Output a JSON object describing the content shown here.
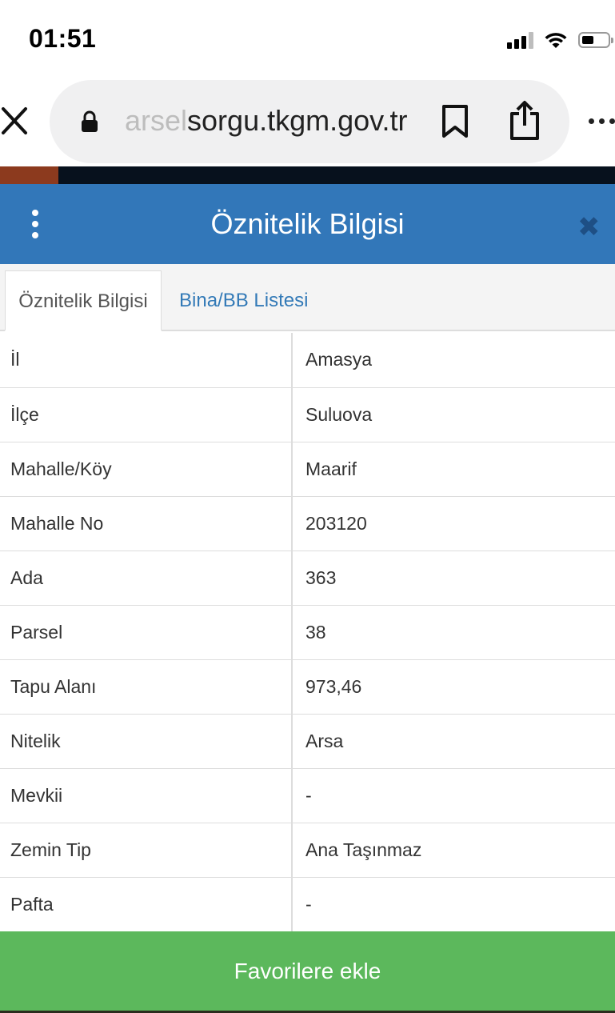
{
  "status_bar": {
    "time": "01:51",
    "battery_level": 0.45
  },
  "browser": {
    "url_faded": "arsel",
    "url_main": "sorgu.tkgm.gov.tr"
  },
  "modal": {
    "title": "Öznitelik Bilgisi",
    "tabs": [
      {
        "label": "Öznitelik Bilgisi",
        "active": true
      },
      {
        "label": "Bina/BB Listesi",
        "active": false
      }
    ],
    "rows": [
      {
        "key": "İl",
        "value": "Amasya"
      },
      {
        "key": "İlçe",
        "value": "Suluova"
      },
      {
        "key": "Mahalle/Köy",
        "value": "Maarif"
      },
      {
        "key": "Mahalle No",
        "value": "203120"
      },
      {
        "key": "Ada",
        "value": "363"
      },
      {
        "key": "Parsel",
        "value": "38"
      },
      {
        "key": "Tapu Alanı",
        "value": "973,46"
      },
      {
        "key": "Nitelik",
        "value": "Arsa"
      },
      {
        "key": "Mevkii",
        "value": "-"
      },
      {
        "key": "Zemin Tip",
        "value": "Ana Taşınmaz"
      },
      {
        "key": "Pafta",
        "value": "-"
      }
    ],
    "footer_button": "Favorilere ekle"
  },
  "colors": {
    "header_blue": "#3277b9",
    "button_green": "#5cb85c",
    "link_blue": "#337ab7"
  }
}
